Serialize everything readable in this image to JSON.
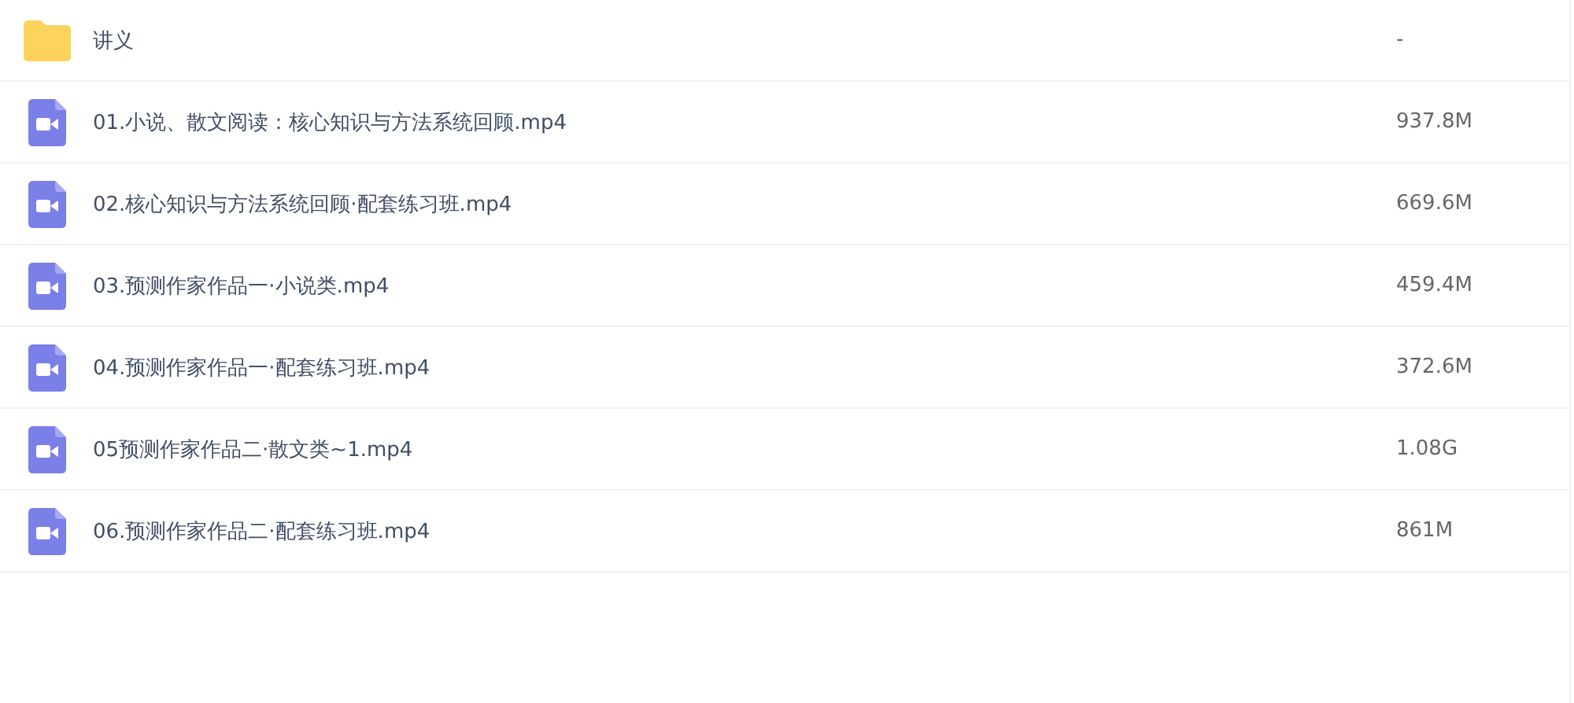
{
  "files": [
    {
      "kind": "folder",
      "name": "讲义",
      "size": "-"
    },
    {
      "kind": "video",
      "name": "01.小说、散文阅读：核心知识与方法系统回顾.mp4",
      "size": "937.8M"
    },
    {
      "kind": "video",
      "name": "02.核心知识与方法系统回顾·配套练习班.mp4",
      "size": "669.6M"
    },
    {
      "kind": "video",
      "name": "03.预测作家作品一·小说类.mp4",
      "size": "459.4M"
    },
    {
      "kind": "video",
      "name": "04.预测作家作品一·配套练习班.mp4",
      "size": "372.6M"
    },
    {
      "kind": "video",
      "name": "05预测作家作品二·散文类~1.mp4",
      "size": "1.08G"
    },
    {
      "kind": "video",
      "name": "06.预测作家作品二·配套练习班.mp4",
      "size": "861M"
    }
  ]
}
